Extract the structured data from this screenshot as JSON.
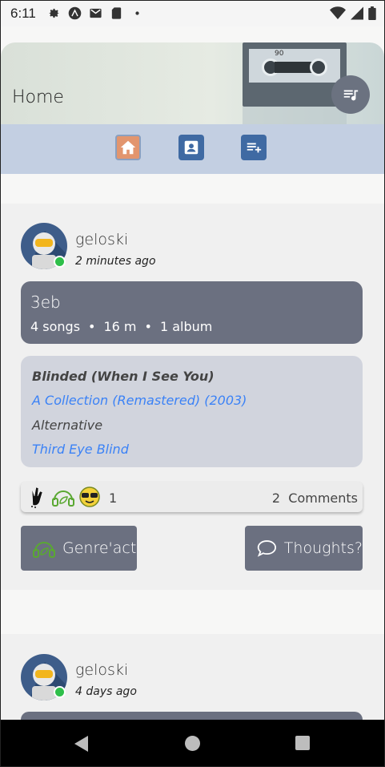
{
  "status_bar": {
    "time": "6:11",
    "icons": [
      "settings-icon",
      "app-icon",
      "gmail-icon",
      "sd-card-icon",
      "dot-icon",
      "wifi-icon",
      "signal-icon",
      "battery-icon"
    ]
  },
  "header": {
    "title": "Home",
    "cassette_number": "90",
    "queue_icon": "queue-music-icon"
  },
  "nav": {
    "items": [
      {
        "icon": "home-icon",
        "active": true
      },
      {
        "icon": "contact-icon",
        "active": false
      },
      {
        "icon": "playlist-add-icon",
        "active": false
      }
    ]
  },
  "posts": [
    {
      "username": "geloski",
      "time_ago": "2 minutes ago",
      "playlist": {
        "name": "3eb",
        "songs": "4 songs",
        "duration": "16 m",
        "albums": "1 album"
      },
      "song": {
        "title": "Blinded (When I See You)",
        "album": "A Collection (Remastered) (2003)",
        "genre": "Alternative",
        "artist": "Third Eye Blind"
      },
      "reactions": {
        "emojis": [
          "rock-hand-icon",
          "headphones-leaf-icon",
          "sunglasses-face-icon"
        ],
        "count": "1",
        "comments_count": "2",
        "comments_label": "Comments"
      },
      "actions": {
        "genreact_label": "Genre'act",
        "thoughts_label": "Thoughts?"
      }
    },
    {
      "username": "geloski",
      "time_ago": "4 days ago"
    }
  ],
  "colors": {
    "nav_band": "#c3cfe2",
    "nav_button": "#3f6aa3",
    "active_nav": "#e2956e",
    "card_dark": "#6b7080",
    "card_light": "#d1d4dd",
    "link": "#3b82f6",
    "online": "#2fbf4a"
  }
}
